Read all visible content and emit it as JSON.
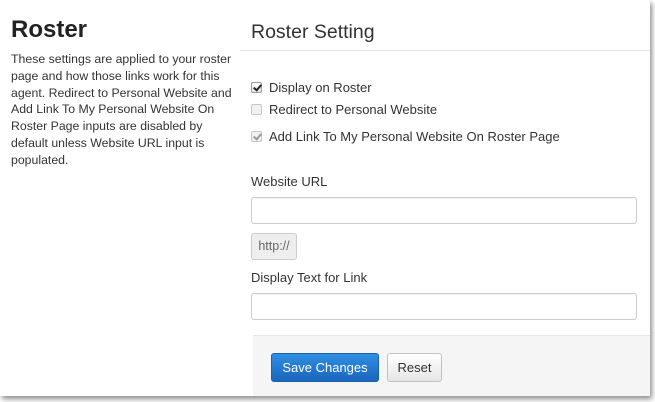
{
  "sidebar": {
    "title": "Roster",
    "description": "These settings are applied to your roster page and how those links work for this agent. Redirect to Personal Website and Add Link To My Personal Website On Roster Page inputs are disabled by default unless Website URL input is populated."
  },
  "main": {
    "title": "Roster Setting",
    "checkboxes": [
      {
        "label": "Display on Roster",
        "checked": true,
        "disabled": false
      },
      {
        "label": "Redirect to Personal Website",
        "checked": false,
        "disabled": true
      },
      {
        "label": "Add Link To My Personal Website On Roster Page",
        "checked": true,
        "disabled": true
      }
    ],
    "website_url": {
      "label": "Website URL",
      "value": "",
      "addon": "http://"
    },
    "display_text": {
      "label": "Display Text for Link",
      "value": ""
    }
  },
  "footer": {
    "save_label": "Save Changes",
    "reset_label": "Reset"
  }
}
